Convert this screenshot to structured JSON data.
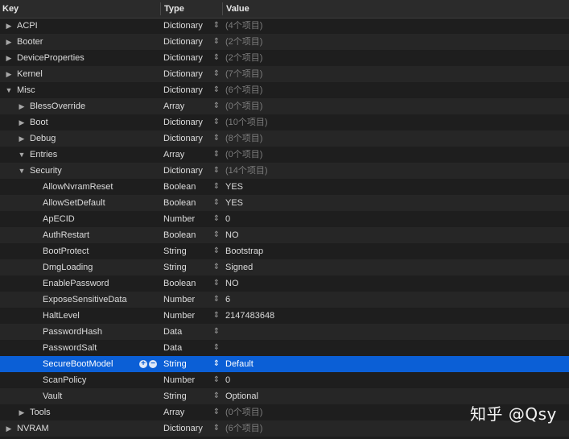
{
  "header": {
    "key": "Key",
    "type": "Type",
    "value": "Value"
  },
  "rows": [
    {
      "key": "ACPI",
      "type": "Dictionary",
      "value": "(4个项目)",
      "depth": 0,
      "expander": "collapsed",
      "muted": true
    },
    {
      "key": "Booter",
      "type": "Dictionary",
      "value": "(2个项目)",
      "depth": 0,
      "expander": "collapsed",
      "muted": true
    },
    {
      "key": "DeviceProperties",
      "type": "Dictionary",
      "value": "(2个项目)",
      "depth": 0,
      "expander": "collapsed",
      "muted": true
    },
    {
      "key": "Kernel",
      "type": "Dictionary",
      "value": "(7个项目)",
      "depth": 0,
      "expander": "collapsed",
      "muted": true
    },
    {
      "key": "Misc",
      "type": "Dictionary",
      "value": "(6个项目)",
      "depth": 0,
      "expander": "expanded",
      "muted": true
    },
    {
      "key": "BlessOverride",
      "type": "Array",
      "value": "(0个项目)",
      "depth": 1,
      "expander": "collapsed",
      "muted": true
    },
    {
      "key": "Boot",
      "type": "Dictionary",
      "value": "(10个项目)",
      "depth": 1,
      "expander": "collapsed",
      "muted": true
    },
    {
      "key": "Debug",
      "type": "Dictionary",
      "value": "(8个项目)",
      "depth": 1,
      "expander": "collapsed",
      "muted": true
    },
    {
      "key": "Entries",
      "type": "Array",
      "value": "(0个项目)",
      "depth": 1,
      "expander": "expanded",
      "muted": true
    },
    {
      "key": "Security",
      "type": "Dictionary",
      "value": "(14个项目)",
      "depth": 1,
      "expander": "expanded",
      "muted": true
    },
    {
      "key": "AllowNvramReset",
      "type": "Boolean",
      "value": "YES",
      "depth": 2,
      "expander": "none"
    },
    {
      "key": "AllowSetDefault",
      "type": "Boolean",
      "value": "YES",
      "depth": 2,
      "expander": "none"
    },
    {
      "key": "ApECID",
      "type": "Number",
      "value": "0",
      "depth": 2,
      "expander": "none"
    },
    {
      "key": "AuthRestart",
      "type": "Boolean",
      "value": "NO",
      "depth": 2,
      "expander": "none"
    },
    {
      "key": "BootProtect",
      "type": "String",
      "value": "Bootstrap",
      "depth": 2,
      "expander": "none"
    },
    {
      "key": "DmgLoading",
      "type": "String",
      "value": "Signed",
      "depth": 2,
      "expander": "none"
    },
    {
      "key": "EnablePassword",
      "type": "Boolean",
      "value": "NO",
      "depth": 2,
      "expander": "none"
    },
    {
      "key": "ExposeSensitiveData",
      "type": "Number",
      "value": "6",
      "depth": 2,
      "expander": "none"
    },
    {
      "key": "HaltLevel",
      "type": "Number",
      "value": "2147483648",
      "depth": 2,
      "expander": "none"
    },
    {
      "key": "PasswordHash",
      "type": "Data",
      "value": "",
      "depth": 2,
      "expander": "none"
    },
    {
      "key": "PasswordSalt",
      "type": "Data",
      "value": "",
      "depth": 2,
      "expander": "none"
    },
    {
      "key": "SecureBootModel",
      "type": "String",
      "value": "Default",
      "depth": 2,
      "expander": "none",
      "selected": true
    },
    {
      "key": "ScanPolicy",
      "type": "Number",
      "value": "0",
      "depth": 2,
      "expander": "none"
    },
    {
      "key": "Vault",
      "type": "String",
      "value": "Optional",
      "depth": 2,
      "expander": "none"
    },
    {
      "key": "Tools",
      "type": "Array",
      "value": "(0个项目)",
      "depth": 1,
      "expander": "collapsed",
      "muted": true
    },
    {
      "key": "NVRAM",
      "type": "Dictionary",
      "value": "(6个项目)",
      "depth": 0,
      "expander": "collapsed",
      "muted": true
    }
  ],
  "icons": {
    "expander_collapsed": "triangle-right-icon",
    "expander_expanded": "triangle-down-icon",
    "stepper": "up-down-chevron-icon",
    "add": "plus-circle-icon",
    "remove": "minus-circle-icon"
  },
  "colors": {
    "background": "#1e1e1e",
    "selection": "#0b5fd6",
    "muted_text": "#7d7d7d"
  },
  "watermark": "知乎 @Qsy"
}
